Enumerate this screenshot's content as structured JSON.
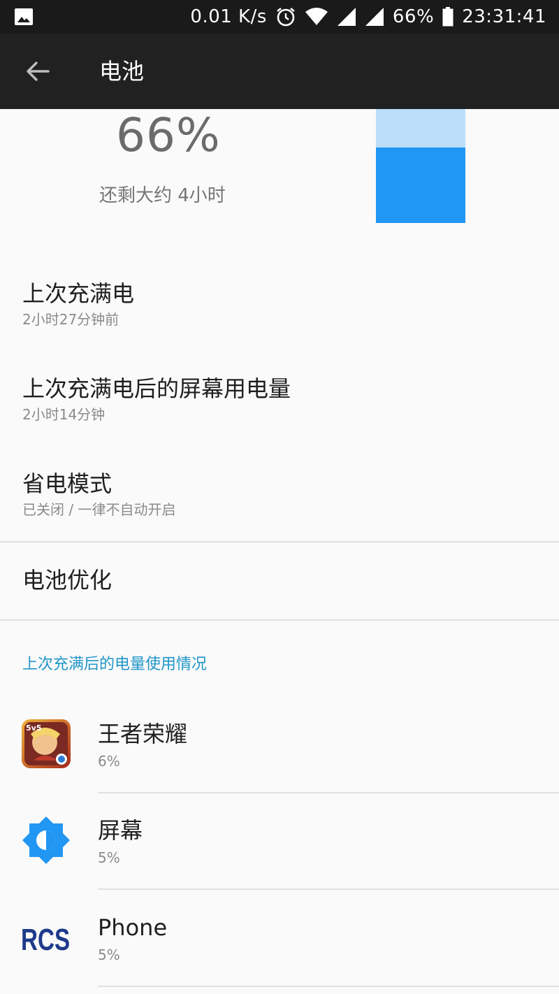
{
  "status_bar": {
    "network_speed": "0.01 K/s",
    "battery_pct": "66%",
    "time": "23:31:41",
    "icons": [
      "image-notification-icon",
      "alarm-icon",
      "wifi-icon",
      "signal-icon",
      "signal-icon",
      "battery-icon"
    ]
  },
  "app_bar": {
    "title": "电池",
    "back_icon": "arrow-back-icon"
  },
  "summary": {
    "percent": "66%",
    "remaining": "还剩大约 4小时",
    "battery_level": 0.66,
    "colors": {
      "fill": "#2196f3",
      "empty": "#bbdefb"
    }
  },
  "prefs": [
    {
      "title": "上次充满电",
      "summary": "2小时27分钟前"
    },
    {
      "title": "上次充满电后的屏幕用电量",
      "summary": "2小时14分钟"
    },
    {
      "title": "省电模式",
      "summary": "已关闭 / 一律不自动开启"
    },
    {
      "title": "电池优化"
    }
  ],
  "usage": {
    "header": "上次充满后的电量使用情况",
    "apps": [
      {
        "name": "王者荣耀",
        "pct": "6%",
        "icon": "game-app-icon"
      },
      {
        "name": "屏幕",
        "pct": "5%",
        "icon": "brightness-icon"
      },
      {
        "name": "Phone",
        "pct": "5%",
        "icon": "rcs-icon",
        "icon_text": "RCS"
      }
    ]
  },
  "colors": {
    "accent": "#2196c8",
    "app_bar": "#212121",
    "status_bar": "#1a1a1a"
  }
}
